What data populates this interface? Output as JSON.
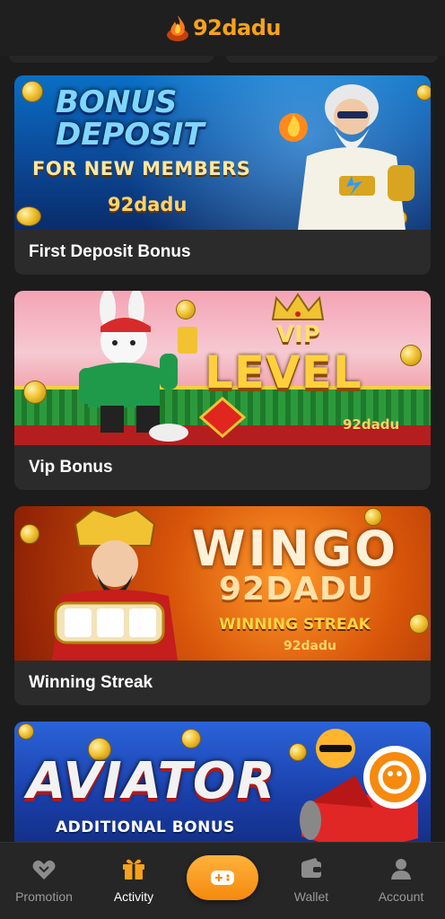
{
  "header": {
    "brand": "92dadu"
  },
  "cards": [
    {
      "title": "First Deposit Bonus",
      "banner": {
        "line1": "BONUS",
        "line2": "DEPOSIT",
        "line3": "FOR NEW MEMBERS",
        "brand": "92dadu"
      }
    },
    {
      "title": "Vip Bonus",
      "banner": {
        "line1": "VIP",
        "line2": "LEVEL",
        "brand": "92dadu"
      }
    },
    {
      "title": "Winning Streak",
      "banner": {
        "line1": "WINGO",
        "line2": "92DADU",
        "line3": "WINNING STREAK",
        "brand": "92dadu"
      }
    },
    {
      "title": "",
      "banner": {
        "line1": "AVIATOR",
        "line2": "ADDITIONAL BONUS"
      }
    }
  ],
  "bottom_nav": {
    "items": [
      {
        "label": "Promotion",
        "icon": "gift-box-icon",
        "active": false
      },
      {
        "label": "Activity",
        "icon": "present-icon",
        "active": true
      },
      {
        "label": "",
        "icon": "gamepad-icon",
        "active": false
      },
      {
        "label": "Wallet",
        "icon": "wallet-icon",
        "active": false
      },
      {
        "label": "Account",
        "icon": "user-icon",
        "active": false
      }
    ]
  },
  "colors": {
    "accent": "#f7a21b",
    "background": "#1c1c1c",
    "card": "#2b2b2b",
    "nav": "#262626"
  }
}
